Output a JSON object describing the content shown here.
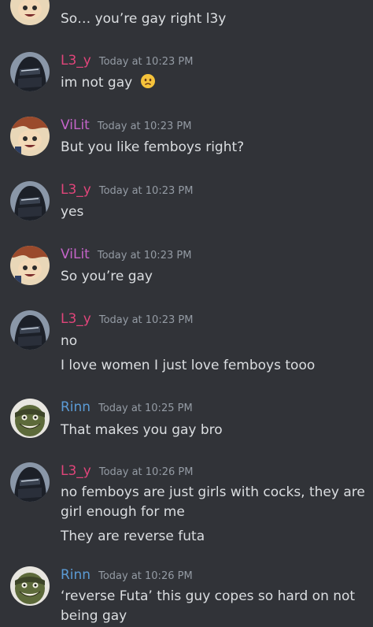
{
  "colors": {
    "background": "#313338",
    "text": "#dbdee1",
    "timestamp": "#949ba4",
    "vilit": "#c464c8",
    "l3y": "#e0457a",
    "rinn": "#5b9bd5"
  },
  "messages": [
    {
      "author": "",
      "avatar": "vilit-avatar",
      "lines": [
        "So… you’re gay right l3y"
      ]
    },
    {
      "author": "L3_y",
      "time": "Today at 10:23 PM",
      "avatar": "l3y-avatar",
      "lines": [
        "im not gay"
      ],
      "emoji": "frowning-face"
    },
    {
      "author": "ViLit",
      "time": "Today at 10:23 PM",
      "avatar": "vilit-avatar",
      "lines": [
        "But you like femboys right?"
      ]
    },
    {
      "author": "L3_y",
      "time": "Today at 10:23 PM",
      "avatar": "l3y-avatar",
      "lines": [
        "yes"
      ]
    },
    {
      "author": "ViLit",
      "time": "Today at 10:23 PM",
      "avatar": "vilit-avatar",
      "lines": [
        "So you’re gay"
      ]
    },
    {
      "author": "L3_y",
      "time": "Today at 10:23 PM",
      "avatar": "l3y-avatar",
      "lines": [
        "no",
        "I love women I just love femboys tooo"
      ]
    },
    {
      "author": "Rinn",
      "time": "Today at 10:25 PM",
      "avatar": "rinn-avatar",
      "lines": [
        "That makes you gay bro"
      ]
    },
    {
      "author": "L3_y",
      "time": "Today at 10:26 PM",
      "avatar": "l3y-avatar",
      "lines": [
        "no femboys are just girls with cocks, they are",
        "girl enough for me",
        "They are reverse futa"
      ]
    },
    {
      "author": "Rinn",
      "time": "Today at 10:26 PM",
      "avatar": "rinn-avatar",
      "lines": [
        "‘reverse Futa’ this guy copes so hard on not",
        "being gay"
      ]
    }
  ]
}
